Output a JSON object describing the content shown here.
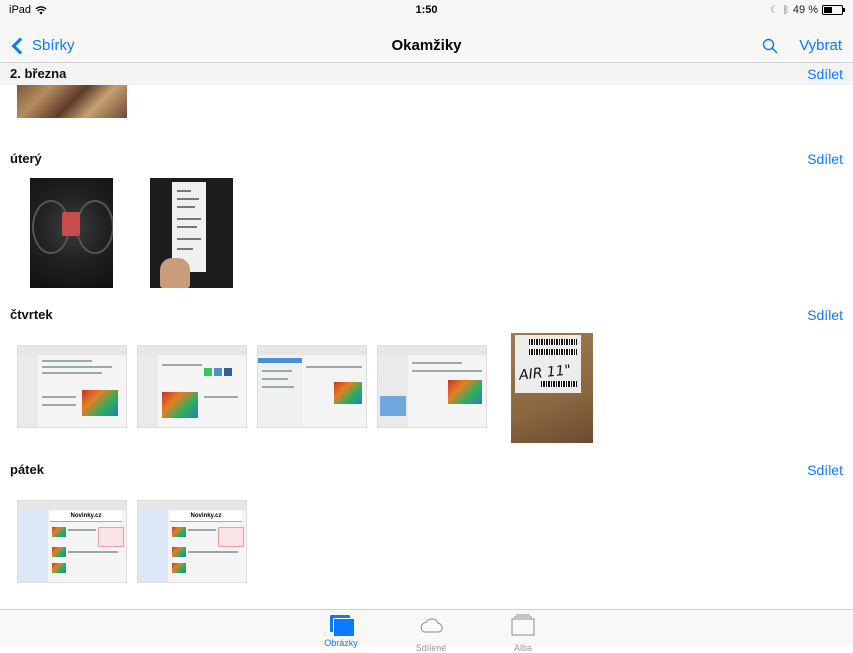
{
  "status_bar": {
    "carrier": "iPad",
    "time": "1:50",
    "battery": "49 %",
    "battery_level": 0.49
  },
  "nav": {
    "back_label": "Sbírky",
    "title": "Okamžiky",
    "select_label": "Vybrat"
  },
  "sections": [
    {
      "title": "2. března",
      "share": "Sdílet"
    },
    {
      "title": "úterý",
      "share": "Sdílet"
    },
    {
      "title": "čtvrtek",
      "share": "Sdílet"
    },
    {
      "title": "pátek",
      "share": "Sdílet"
    }
  ],
  "photos": {
    "box_text": "AIR 11\"",
    "news_title": "Novinky.cz"
  },
  "tabs": [
    {
      "label": "Obrázky",
      "icon": "photos-icon",
      "active": true
    },
    {
      "label": "Sdílené",
      "icon": "cloud-icon",
      "active": false
    },
    {
      "label": "Alba",
      "icon": "albums-icon",
      "active": false
    }
  ],
  "colors": {
    "accent": "#0a7aff",
    "bar_background": "#f7f7f7"
  }
}
